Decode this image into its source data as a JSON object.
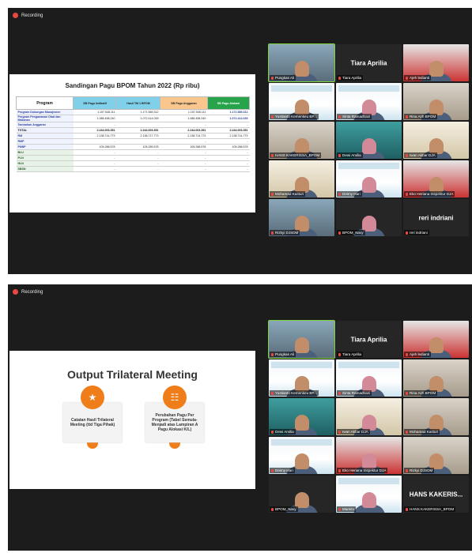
{
  "recording_label": "Recording",
  "frame1": {
    "slide": {
      "title": "Sandingan Pagu BPOM Tahun 2022 (Rp ribu)",
      "headers": [
        "Program",
        "SB Pagu Indikatif",
        "Hasil TM 1 BPOM",
        "SB Pagu Anggaran",
        "SB Pagu Alokasi"
      ],
      "rows": [
        {
          "label": "Program Dukungan Manajemen",
          "values": [
            "1.157.545.111",
            "1.171.589.312",
            "1.157.545.111",
            "1.171.589.312"
          ]
        },
        {
          "label": "Program Pengawasan Obat dan Makanan",
          "values": [
            "1.086.458.240",
            "1.072.414.039",
            "1.086.458.240",
            "1.072.414.039"
          ]
        },
        {
          "label": "Tambahan Anggaran",
          "values": [
            "-",
            "-",
            "-",
            "-"
          ]
        },
        {
          "label": "TOTAL",
          "values": [
            "2.244.003.351",
            "2.244.003.351",
            "2.244.003.351",
            "2.244.003.351"
          ]
        },
        {
          "label": "RM",
          "values": [
            "2.138.714.773",
            "2.138.717.773",
            "2.138.714.773",
            "2.138.714.773"
          ]
        },
        {
          "label": "RMP",
          "values": [
            "-",
            "-",
            "-",
            "-"
          ]
        },
        {
          "label": "PNBP",
          "values": [
            "105.288.578",
            "105.285.578",
            "105.288.578",
            "105.288.578"
          ]
        },
        {
          "label": "BLU",
          "values": [
            "-",
            "-",
            "-",
            "-"
          ]
        },
        {
          "label": "PLN",
          "values": [
            "-",
            "-",
            "-",
            "-"
          ]
        },
        {
          "label": "HLN",
          "values": [
            "-",
            "-",
            "-",
            "-"
          ]
        },
        {
          "label": "SBSN",
          "values": [
            "-",
            "-",
            "-",
            "-"
          ]
        }
      ]
    },
    "tiles": [
      {
        "name": "Pungkas Ali",
        "style": "person",
        "active": true
      },
      {
        "name": "Tiara Aprilia",
        "style": "dark",
        "big": "Tiara Aprilia"
      },
      {
        "name": "Ajeh ledianti",
        "style": "red"
      },
      {
        "name": "Yustianto Kemenkeu BP...",
        "style": "pres"
      },
      {
        "name": "Sinta Ramadhani",
        "style": "pres"
      },
      {
        "name": "Rina Azh BPOM",
        "style": "room"
      },
      {
        "name": "HANS KAKERISSA_BPOM",
        "style": "room"
      },
      {
        "name": "Dewi Amilia",
        "style": "teal"
      },
      {
        "name": "Iwan Akbar DJA",
        "style": "cream"
      },
      {
        "name": "Mohamad Kasturi",
        "style": "cream"
      },
      {
        "name": "Deimy Hari",
        "style": "pres"
      },
      {
        "name": "Eko Heriana Inspektur DJA",
        "style": "red"
      },
      {
        "name": "Rizkyi DJSDM",
        "style": "person"
      },
      {
        "name": "BPOM_Navy",
        "style": "dark"
      },
      {
        "name": "reri indriani",
        "style": "dark",
        "big": "reri indriani"
      }
    ]
  },
  "frame2": {
    "slide": {
      "title": "Output Trilateral Meeting",
      "card1": "Catatan Hasil Trilateral Meeting (ttd Tiga Pihak)",
      "card2": "Perubahan Pagu Per Program (Tabel Semula-Menjadi atas Lampiran A Pagu Alokasi K/L)"
    },
    "tiles": [
      {
        "name": "Pungkas Ali",
        "style": "person",
        "active": true
      },
      {
        "name": "Tiara Aprilia",
        "style": "dark",
        "big": "Tiara Aprilia"
      },
      {
        "name": "Ajeh ledianti",
        "style": "red"
      },
      {
        "name": "Yustianto Kemenkeu BP...",
        "style": "pres"
      },
      {
        "name": "Sinta Ramadhani",
        "style": "pres"
      },
      {
        "name": "Rina Azh BPOM",
        "style": "room"
      },
      {
        "name": "Dewi Amilia",
        "style": "teal"
      },
      {
        "name": "Iwan Akbar DJA",
        "style": "cream"
      },
      {
        "name": "Mohamad Kasturi",
        "style": "room"
      },
      {
        "name": "Deimy Hari",
        "style": "pres"
      },
      {
        "name": "Eko Heriana Inspektur DJA",
        "style": "red"
      },
      {
        "name": "Rizkyi DJSDM",
        "style": "room"
      },
      {
        "name": "BPOM_Navy",
        "style": "dark"
      },
      {
        "name": "Marsito",
        "style": "pres"
      },
      {
        "name": "HANS KAKERISSA_BPOM",
        "style": "dark",
        "big": "HANS KAKERIS..."
      }
    ]
  }
}
